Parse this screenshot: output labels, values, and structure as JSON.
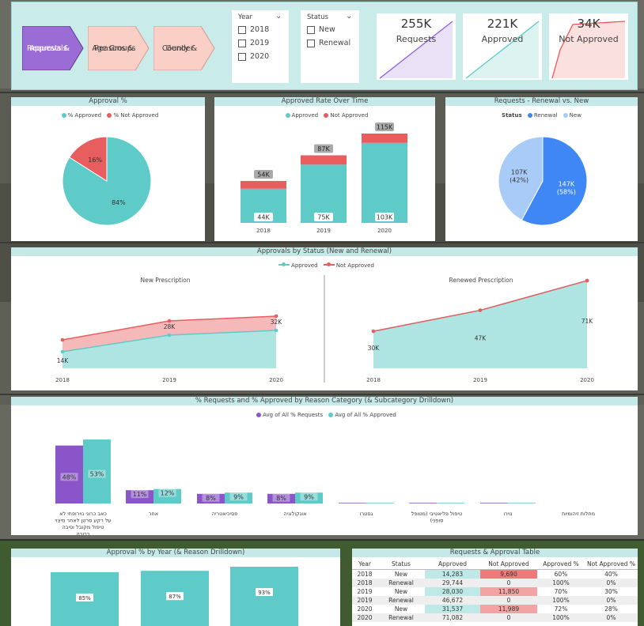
{
  "nav": {
    "buttons": [
      {
        "label_line1": "Requests &",
        "label_line2": "Approvals",
        "active": true
      },
      {
        "label_line1": "Reasons &",
        "label_line2": "Age Groups",
        "active": false
      },
      {
        "label_line1": "County &",
        "label_line2": "Gender",
        "active": false
      }
    ]
  },
  "slicers": {
    "year": {
      "header": "Year",
      "options": [
        "2018",
        "2019",
        "2020"
      ]
    },
    "status": {
      "header": "Status",
      "options": [
        "New",
        "Renewal"
      ]
    }
  },
  "kpis": [
    {
      "value": "255K",
      "label": "Requests",
      "color": "#8f5fd6"
    },
    {
      "value": "221K",
      "label": "Approved",
      "color": "#5ec9c6"
    },
    {
      "value": "34K",
      "label": "Not Approved",
      "color": "#e85858"
    }
  ],
  "colors": {
    "approved": "#5ecbc8",
    "not_approved": "#e85d5d",
    "request": "#8a55c8",
    "renewal": "#3e87f5",
    "new": "#a9cbf7"
  },
  "approval_pct": {
    "title": "Approval %",
    "legend": [
      "% Approved",
      "% Not Approved"
    ],
    "chart_data": {
      "type": "pie",
      "labels": [
        "% Approved",
        "% Not Approved"
      ],
      "values": [
        84,
        16
      ],
      "value_labels": [
        "84%",
        "16%"
      ]
    }
  },
  "approved_rate": {
    "title": "Approved Rate Over Time",
    "legend": [
      "Approved",
      "Not Approved"
    ],
    "chart_data": {
      "type": "bar",
      "categories": [
        "2018",
        "2019",
        "2020"
      ],
      "series": [
        {
          "name": "Approved",
          "values": [
            44,
            75,
            103
          ],
          "value_labels": [
            "44K",
            "75K",
            "103K"
          ]
        },
        {
          "name": "Not Approved",
          "values": [
            10,
            12,
            12
          ]
        }
      ],
      "totals": [
        54,
        87,
        115
      ],
      "total_labels": [
        "54K",
        "87K",
        "115K"
      ]
    }
  },
  "renewal_new": {
    "title": "Requests - Renewal vs. New",
    "legend_title": "Status",
    "legend": [
      "Renewal",
      "New"
    ],
    "chart_data": {
      "type": "pie",
      "labels": [
        "Renewal",
        "New"
      ],
      "values": [
        147,
        107
      ],
      "value_labels": [
        "147K",
        "107K"
      ],
      "pct_labels": [
        "(58%)",
        "(42%)"
      ]
    }
  },
  "by_status": {
    "title": "Approvals by Status (New and Renewal)",
    "legend": [
      "Approved",
      "Not Approved"
    ],
    "charts": [
      {
        "subtitle": "New Prescription",
        "chart_data": {
          "type": "area",
          "x": [
            "2018",
            "2019",
            "2020"
          ],
          "series": [
            {
              "name": "Approved",
              "values": [
                14,
                28,
                32
              ],
              "value_labels": [
                "14K",
                "28K",
                "32K"
              ]
            },
            {
              "name": "Not Approved",
              "values": [
                24,
                40,
                44
              ]
            }
          ],
          "ylim": [
            0,
            100
          ]
        }
      },
      {
        "subtitle": "Renewed Prescription",
        "chart_data": {
          "type": "area",
          "x": [
            "2018",
            "2019",
            "2020"
          ],
          "series": [
            {
              "name": "Approved",
              "values": [
                30,
                47,
                71
              ],
              "value_labels": [
                "30K",
                "47K",
                "71K"
              ]
            },
            {
              "name": "Not Approved",
              "values": [
                30,
                47,
                71
              ]
            }
          ],
          "ylim": [
            0,
            80
          ]
        }
      }
    ]
  },
  "reason_category": {
    "title": "% Requests and % Approved by Reason Category (& Subcategory Drilldown)",
    "legend": [
      "Avg of All % Requests",
      "Avg of All % Approved"
    ],
    "chart_data": {
      "type": "bar",
      "categories": [
        "כאב כרוני נוירופתי לא על רקע סרטן לאחר מיצוי טיפול מקובל וסיבה ברורה",
        "אחר",
        "פסיכיאטריה",
        "אונקולוגיה",
        "גסטרו",
        "טיפול פליאטיבי (מטופל סופני)",
        "נוירו",
        "מחלות זיהומיות"
      ],
      "series": [
        {
          "name": "Avg of All % Requests",
          "values": [
            48,
            11,
            8,
            8,
            0.5,
            0.5,
            0.5,
            0
          ],
          "value_labels": [
            "48%",
            "11%",
            "8%",
            "8%",
            "",
            "",
            "",
            ""
          ]
        },
        {
          "name": "Avg of All % Approved",
          "values": [
            53,
            12,
            9,
            9,
            0.5,
            0.5,
            0.5,
            0
          ],
          "value_labels": [
            "53%",
            "12%",
            "9%",
            "9%",
            "",
            "",
            "",
            ""
          ]
        }
      ],
      "ylim": [
        0,
        55
      ]
    }
  },
  "approval_year": {
    "title": "Approval % by Year (& Reason Drilldown)",
    "chart_data": {
      "type": "bar",
      "categories": [
        "2018",
        "2019",
        "2020"
      ],
      "values": [
        85,
        87,
        93
      ],
      "value_labels": [
        "85%",
        "87%",
        "93%"
      ],
      "ylim": [
        0,
        100
      ]
    }
  },
  "table": {
    "title": "Requests & Approval Table",
    "columns": [
      "Year",
      "Status",
      "Approved",
      "Not Approved",
      "Approved %",
      "Not Approved %"
    ],
    "rows": [
      [
        "2018",
        "New",
        "14,283",
        "9,690",
        "60%",
        "40%"
      ],
      [
        "2018",
        "Renewal",
        "29,744",
        "0",
        "100%",
        "0%"
      ],
      [
        "2019",
        "New",
        "28,030",
        "11,850",
        "70%",
        "30%"
      ],
      [
        "2019",
        "Renewal",
        "46,672",
        "0",
        "100%",
        "0%"
      ],
      [
        "2020",
        "New",
        "31,537",
        "11,989",
        "72%",
        "28%"
      ],
      [
        "2020",
        "Renewal",
        "71,082",
        "0",
        "100%",
        "0%"
      ]
    ]
  }
}
